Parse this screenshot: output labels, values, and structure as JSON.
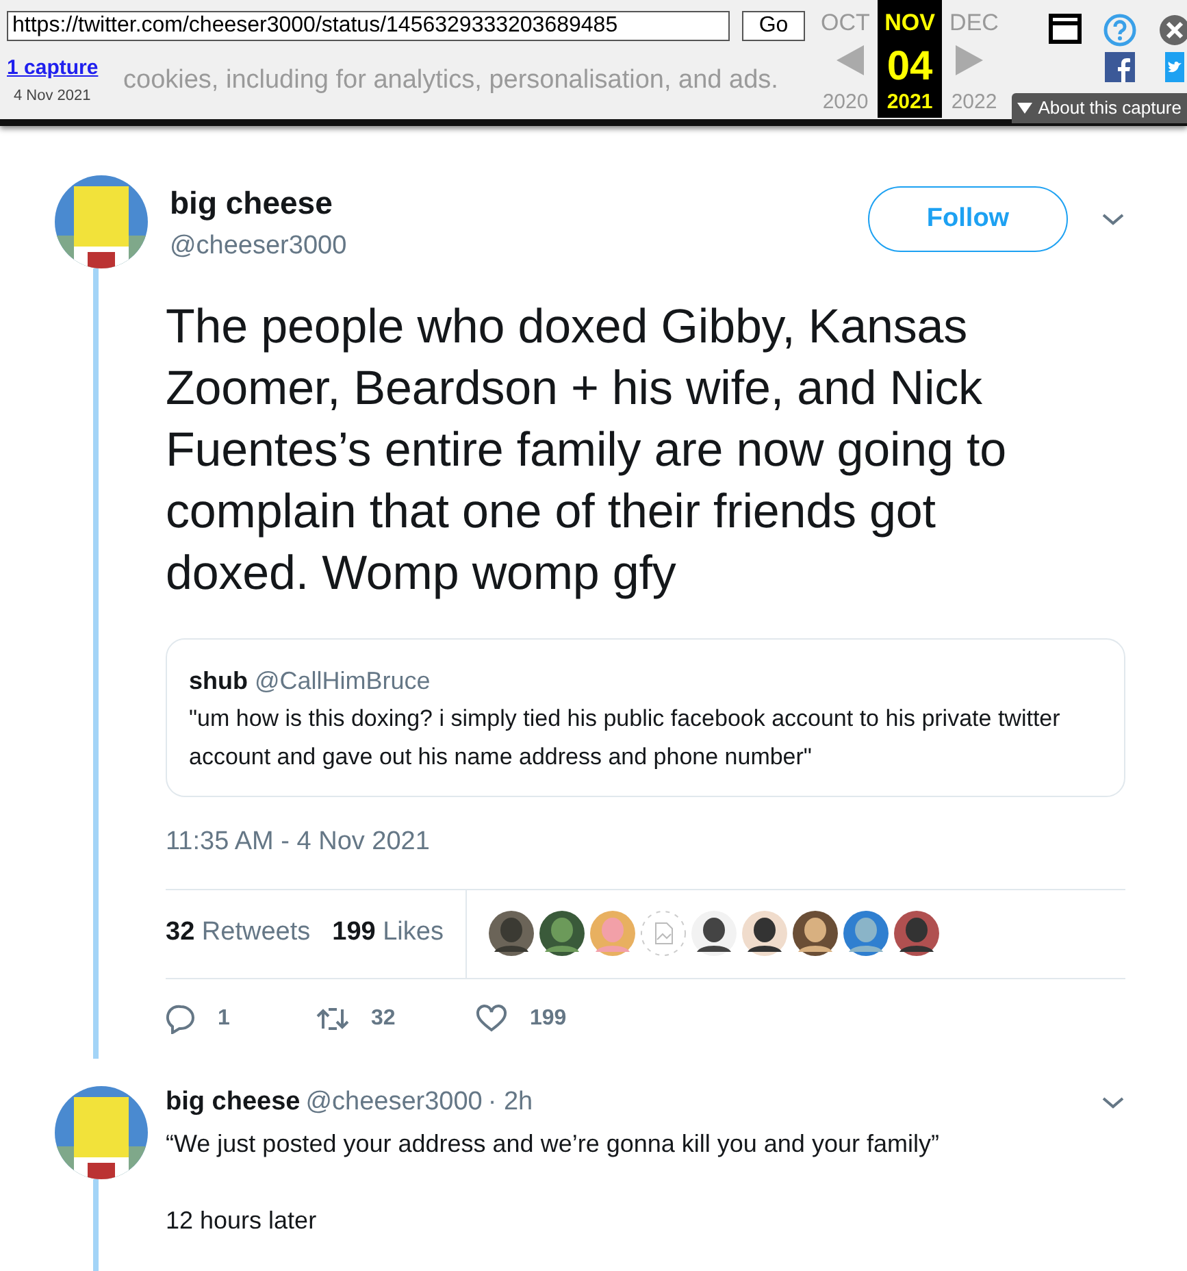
{
  "wayback": {
    "url": "https://twitter.com/cheeser3000/status/1456329333203689485",
    "go": "Go",
    "captures": "1 capture",
    "capture_date": "4 Nov 2021",
    "background_text": "cookies, including for analytics, personalisation, and ads.",
    "months": [
      {
        "label": "OCT",
        "year": "2020",
        "selected": false
      },
      {
        "label": "NOV",
        "day": "04",
        "year": "2021",
        "selected": true
      },
      {
        "label": "DEC",
        "year": "2022",
        "selected": false
      }
    ],
    "about": "About this capture"
  },
  "tweet": {
    "name": "big cheese",
    "handle": "@cheeser3000",
    "follow": "Follow",
    "text": "The people who doxed Gibby, Kansas Zoomer, Beardson + his wife, and Nick Fuentes’s entire family are now going to complain that one of their friends got doxed. Womp womp gfy",
    "quote": {
      "name": "shub",
      "handle": "@CallHimBruce",
      "text": "\"um how is this doxing? i simply tied his public facebook account to his private twitter account and gave out his name address and phone number\""
    },
    "time": "11:35 AM - 4 Nov 2021",
    "stats": [
      {
        "count": "32",
        "label": "Retweets"
      },
      {
        "count": "199",
        "label": "Likes"
      }
    ],
    "likers": [
      {
        "kind": "picture"
      },
      {
        "kind": "picture"
      },
      {
        "kind": "picture"
      },
      {
        "kind": "broken"
      },
      {
        "kind": "picture"
      },
      {
        "kind": "picture"
      },
      {
        "kind": "picture"
      },
      {
        "kind": "picture"
      },
      {
        "kind": "picture"
      }
    ],
    "actions": [
      {
        "kind": "reply",
        "count": "1"
      },
      {
        "kind": "retweet",
        "count": "32"
      },
      {
        "kind": "like",
        "count": "199"
      }
    ]
  },
  "reply": {
    "name": "big cheese",
    "handle": "@cheeser3000",
    "time": "· 2h",
    "lines": [
      "“We just posted your address and we’re gonna kill you and your family”",
      "12 hours later"
    ]
  }
}
